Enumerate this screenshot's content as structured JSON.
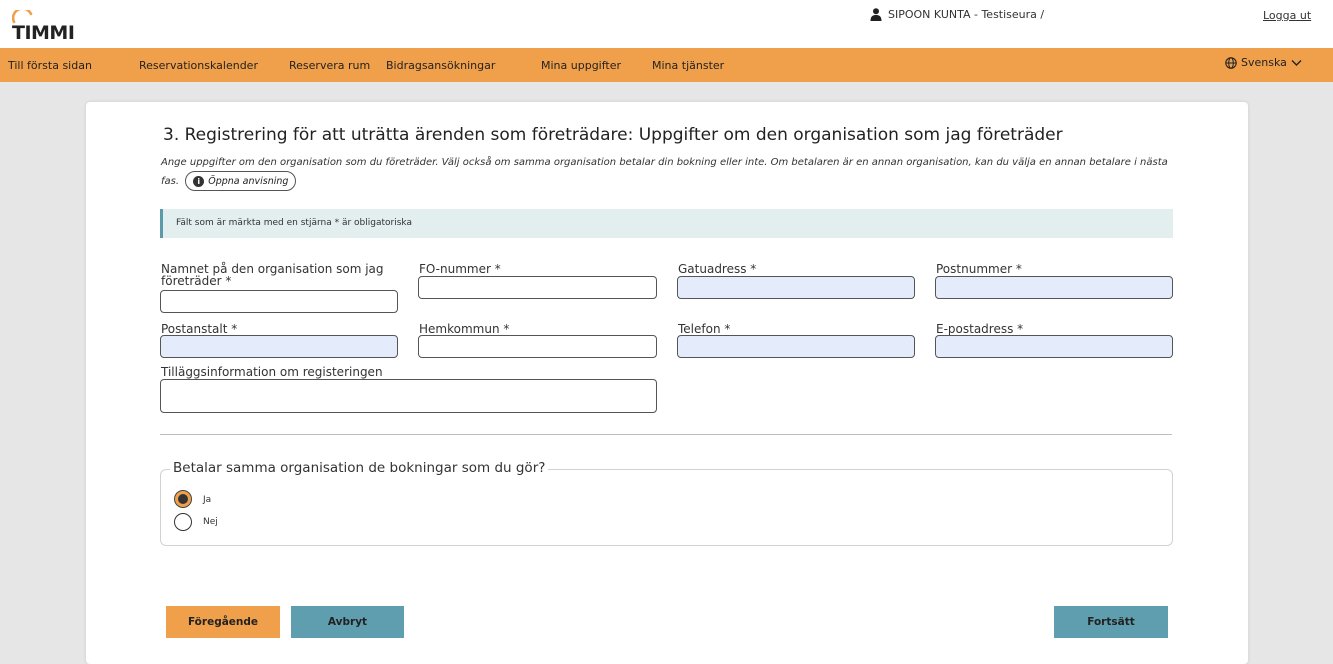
{
  "header": {
    "logo_text": "TIMMI",
    "user_label": "SIPOON KUNTA - Testiseura /",
    "logout_label": "Logga ut",
    "user_icon": "person-icon"
  },
  "nav": {
    "items": [
      "Till första sidan",
      "Reservationskalender",
      "Reservera rum",
      "Bidragsansökningar",
      "Mina uppgifter",
      "Mina tjänster"
    ],
    "language": "Svenska",
    "language_icon": "globe-icon"
  },
  "form": {
    "title": "3. Registrering för att uträtta ärenden som företrädare: Uppgifter om den organisation som jag företräder",
    "description": "Ange uppgifter om den organisation som du företräder. Välj också om samma organisation betalar din bokning eller inte. Om betalaren är en annan organisation, kan du välja en annan betalare i nästa fas.",
    "guide_button": "Öppna anvisning",
    "required_notice": "Fält som är märkta med en stjärna * är obligatoriska",
    "fields": {
      "org_name": "Namnet på den organisation som jag företräder *",
      "fo_number": "FO-nummer *",
      "street": "Gatuadress *",
      "postal_code": "Postnummer *",
      "post_office": "Postanstalt *",
      "municipality": "Hemkommun *",
      "phone": "Telefon *",
      "email": "E-postadress *",
      "additional_info": "Tilläggsinformation om registeringen"
    },
    "payer_question": "Betalar samma organisation de bokningar som du gör?",
    "payer_options": [
      "Ja",
      "Nej"
    ],
    "payer_selected": "Ja"
  },
  "buttons": {
    "previous": "Föregående",
    "cancel": "Avbryt",
    "continue": "Fortsätt"
  },
  "colors": {
    "nav_bg": "#f0a04b",
    "teal_button": "#5f9eaf",
    "autofill_input": "#e4ecfb",
    "notice_bg": "#e3eeef"
  }
}
